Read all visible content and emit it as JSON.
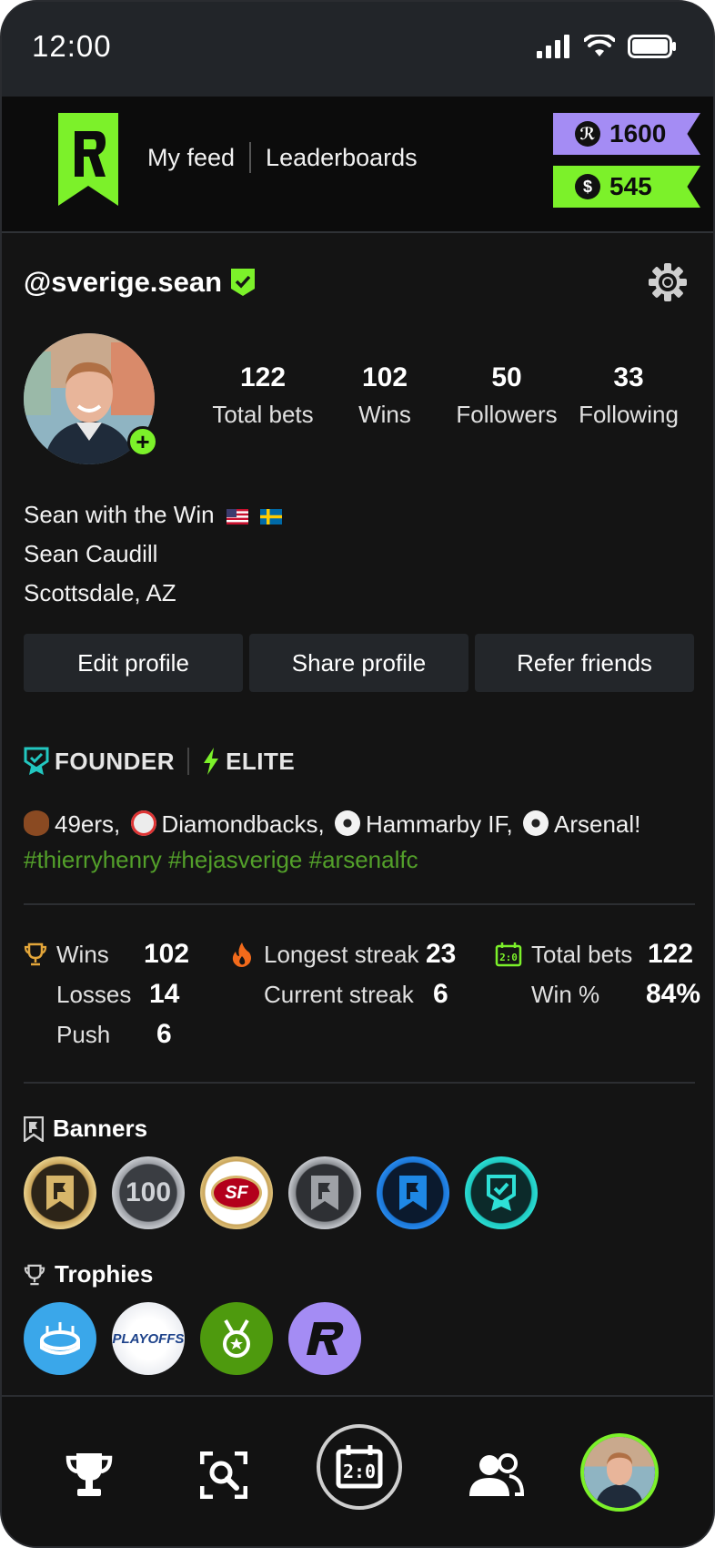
{
  "status_bar": {
    "time": "12:00"
  },
  "header": {
    "nav": [
      {
        "label": "My feed"
      },
      {
        "label": "Leaderboards"
      }
    ],
    "points_balance": "1600",
    "cash_balance": "545",
    "colors": {
      "points": "#a48cf4",
      "cash": "#7cf12a"
    }
  },
  "profile": {
    "username": "@sverige.sean",
    "stats": [
      {
        "value": "122",
        "label": "Total bets"
      },
      {
        "value": "102",
        "label": "Wins"
      },
      {
        "value": "50",
        "label": "Followers"
      },
      {
        "value": "33",
        "label": "Following"
      }
    ],
    "display_name": "Sean with the Win",
    "full_name": "Sean Caudill",
    "location": "Scottsdale, AZ"
  },
  "actions": {
    "edit": "Edit profile",
    "share": "Share profile",
    "refer": "Refer friends"
  },
  "badges": {
    "founder": "FOUNDER",
    "elite": "ELITE"
  },
  "interests": {
    "teams": [
      "49ers,",
      "Diamondbacks,",
      "Hammarby IF,",
      "Arsenal!"
    ],
    "hashtags": "#thierryhenry #hejasverige #arsenalfc"
  },
  "record": {
    "wins_label": "Wins",
    "wins": "102",
    "losses_label": "Losses",
    "losses": "14",
    "push_label": "Push",
    "push": "6",
    "longest_label": "Longest streak",
    "longest": "23",
    "current_label": "Current streak",
    "current": "6",
    "total_label": "Total bets",
    "total": "122",
    "winpct_label": "Win %",
    "winpct": "84%"
  },
  "banners": {
    "title": "Banners",
    "items": [
      {
        "icon": "gold-flag-banner-icon"
      },
      {
        "icon": "hundred-banner-icon",
        "text": "100"
      },
      {
        "icon": "49ers-logo-banner-icon",
        "text": "SF"
      },
      {
        "icon": "silver-flag-banner-icon"
      },
      {
        "icon": "blue-flag-banner-icon"
      },
      {
        "icon": "teal-check-banner-icon"
      }
    ]
  },
  "trophies": {
    "title": "Trophies",
    "items": [
      {
        "icon": "stadium-trophy-icon"
      },
      {
        "icon": "playoffs-trophy-icon",
        "text": "PLAYOFFS"
      },
      {
        "icon": "medal-trophy-icon"
      },
      {
        "icon": "brand-r-trophy-icon"
      }
    ]
  },
  "tabbar": {
    "items": [
      {
        "icon": "trophy-icon"
      },
      {
        "icon": "search-scan-icon"
      },
      {
        "icon": "scoreboard-icon",
        "text": "2:0"
      },
      {
        "icon": "people-icon"
      },
      {
        "icon": "profile-avatar-icon"
      }
    ]
  }
}
